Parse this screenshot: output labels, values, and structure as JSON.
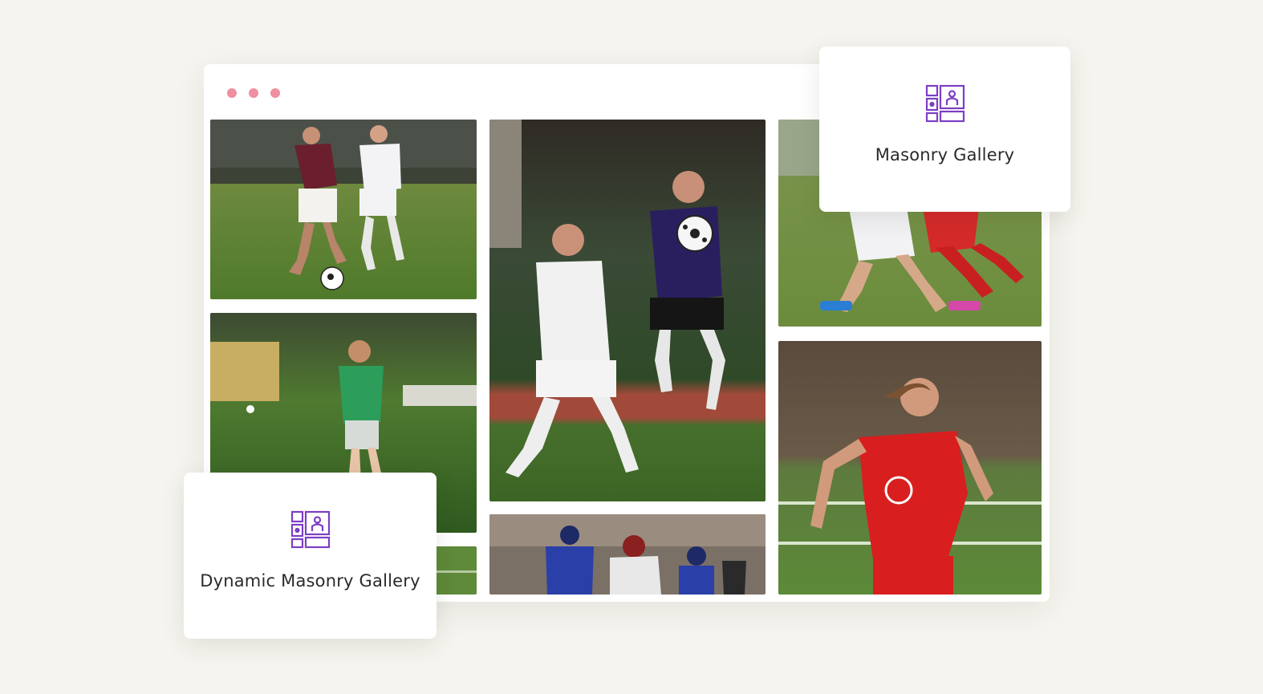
{
  "window": {
    "dot_color": "#ef8fa0"
  },
  "gallery": {
    "photos": [
      {
        "id": "p1",
        "subject": "two soccer players chasing ball"
      },
      {
        "id": "p2",
        "subject": "player heading ball vs defender"
      },
      {
        "id": "p3",
        "subject": "players legs in red and white kits"
      },
      {
        "id": "p4",
        "subject": "young player in green kicking ball"
      },
      {
        "id": "p5",
        "subject": "player in red jersey number 9"
      },
      {
        "id": "p6",
        "subject": "american football players"
      },
      {
        "id": "p7",
        "subject": "field partial"
      }
    ]
  },
  "cards": {
    "masonry": {
      "label": "Masonry Gallery",
      "icon": "masonry-gallery-icon"
    },
    "dynamic": {
      "label": "Dynamic Masonry Gallery",
      "icon": "masonry-gallery-icon"
    }
  },
  "colors": {
    "accent": "#7b3fc4",
    "background": "#f5f4ee"
  }
}
